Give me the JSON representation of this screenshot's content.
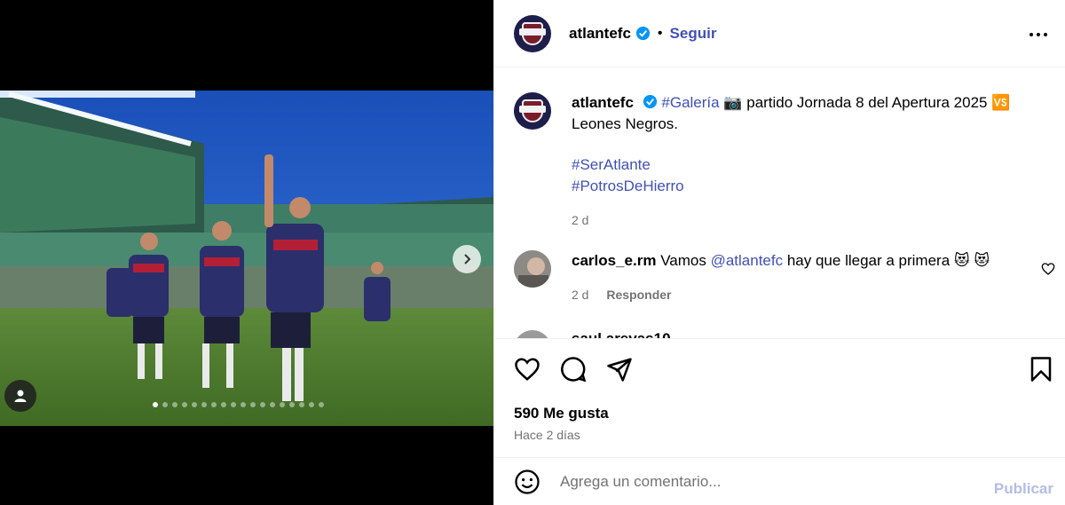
{
  "post": {
    "username": "atlantefc",
    "follow_label": "Seguir",
    "bullet": "•",
    "more_icon": "more-horizontal-icon"
  },
  "caption": {
    "username": "atlantefc",
    "hashtag_gallery": "#Galería",
    "camera_emoji": "📷",
    "text_main": "partido Jornada 8 del Apertura 2025",
    "vs_emoji": "🆚",
    "text_end": "Leones Negros.",
    "hashtag_1": "#SerAtlante",
    "hashtag_2": "#PotrosDeHierro",
    "time": "2 d"
  },
  "comment": {
    "username": "carlos_e.rm",
    "text_pre": "Vamos",
    "mention": "@atlantefc",
    "text_post": "hay que llegar a primera",
    "emoji": "😻 😻",
    "time": "2 d",
    "reply_label": "Responder"
  },
  "comment2": {
    "username_partial": "saul.arevas10"
  },
  "stats": {
    "likes": "590 Me gusta",
    "ago": "Hace 2 días"
  },
  "composer": {
    "placeholder": "Agrega un comentario...",
    "publish_label": "Publicar"
  },
  "carousel": {
    "dot_count": 18,
    "active_index": 0
  },
  "colors": {
    "link": "#4150b5",
    "verified": "#0095f6",
    "muted": "#737373",
    "publish_disabled": "#b4bce8"
  }
}
